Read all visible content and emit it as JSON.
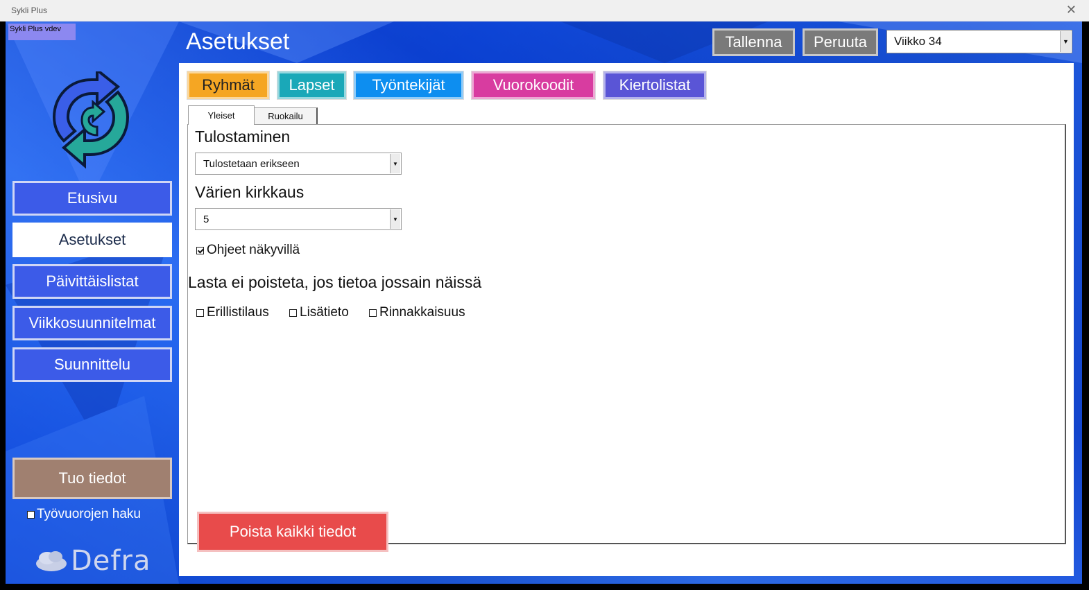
{
  "window": {
    "title": "Sykli Plus",
    "close_glyph": "✕"
  },
  "version_badge": "Sykli Plus vdev",
  "sidebar": {
    "items": [
      {
        "label": "Etusivu",
        "active": false
      },
      {
        "label": "Asetukset",
        "active": true
      },
      {
        "label": "Päivittäislistat",
        "active": false
      },
      {
        "label": "Viikkosuunnitelmat",
        "active": false
      },
      {
        "label": "Suunnittelu",
        "active": false
      }
    ],
    "import_button": "Tuo tiedot",
    "shift_fetch_checkbox": {
      "label": "Työvuorojen haku",
      "checked": false
    },
    "brand": "Defra"
  },
  "header": {
    "title": "Asetukset",
    "save_label": "Tallenna",
    "cancel_label": "Peruuta",
    "week_select": "Viikko 34"
  },
  "categories": [
    {
      "label": "Ryhmät",
      "color": "#f5a623",
      "text_color": "#222"
    },
    {
      "label": "Lapset",
      "color": "#1aa8b8",
      "text_color": "#fff"
    },
    {
      "label": "Työntekijät",
      "color": "#0d8ef0",
      "text_color": "#fff"
    },
    {
      "label": "Vuorokoodit",
      "color": "#d83ca0",
      "text_color": "#fff"
    },
    {
      "label": "Kiertolistat",
      "color": "#5a55d6",
      "text_color": "#fff"
    }
  ],
  "tabs": [
    {
      "label": "Yleiset",
      "active": true
    },
    {
      "label": "Ruokailu",
      "active": false
    }
  ],
  "settings": {
    "printing": {
      "label": "Tulostaminen",
      "value": "Tulostetaan erikseen"
    },
    "brightness": {
      "label": "Värien kirkkaus",
      "value": "5"
    },
    "show_instructions": {
      "label": "Ohjeet näkyvillä",
      "checked": true
    },
    "no_delete_heading": "Lasta ei poisteta, jos tietoa jossain näissä",
    "no_delete_options": [
      {
        "label": "Erillistilaus",
        "checked": false
      },
      {
        "label": "Lisätieto",
        "checked": false
      },
      {
        "label": "Rinnakkaisuus",
        "checked": false
      }
    ],
    "delete_all_label": "Poista kaikki tiedot"
  }
}
